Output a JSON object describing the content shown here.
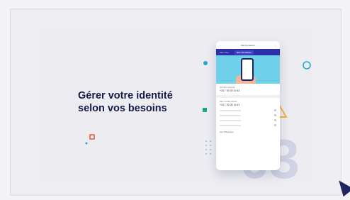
{
  "slide": {
    "headline_line1": "Gérer votre identité",
    "headline_line2": "selon vos besoins",
    "big_number": "03"
  },
  "phone": {
    "header_title": "Ma Connexion",
    "tabs": [
      "Mes infos",
      "Mes identifiants"
    ],
    "number_label": "Numéro associé",
    "number_value": "+33 7 00 00 19 43",
    "number2_label": "Mon mobile actuel",
    "number2_value": "+33 7 00 00 19 43",
    "footer_text": "Lier l'Outil Duo"
  },
  "colors": {
    "headline": "#151b4a",
    "phone_tab_bar": "#2b2fa8",
    "hero": "#6fd0ea",
    "triangle": "#f0b33b",
    "teal": "#1aa78f",
    "circle": "#2aa6c9"
  }
}
